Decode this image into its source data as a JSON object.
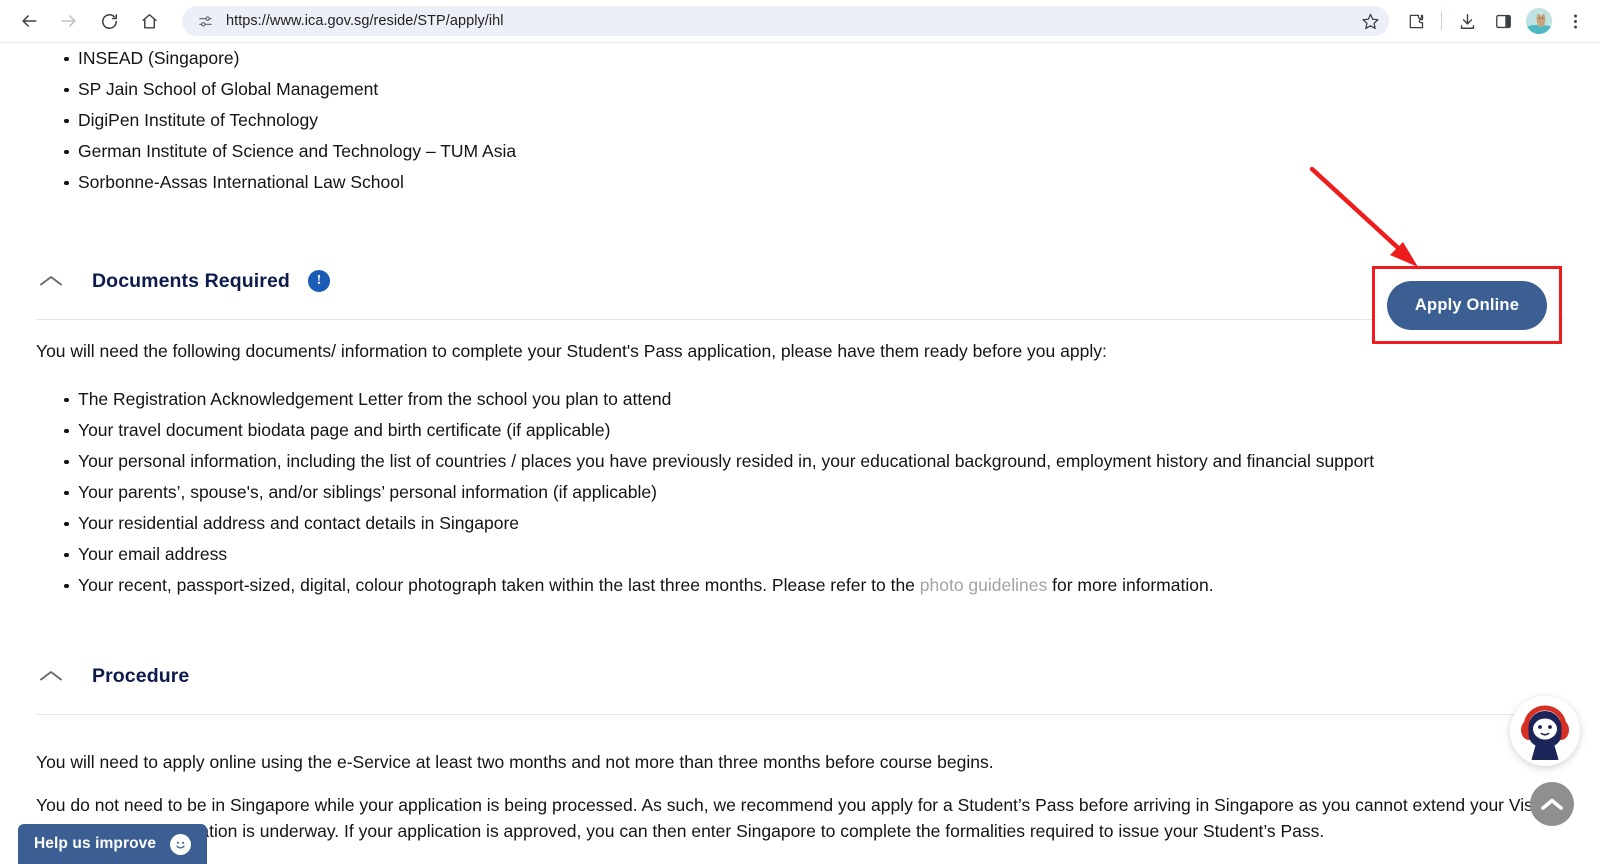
{
  "browser": {
    "back_label": "Back",
    "forward_label": "Forward",
    "reload_label": "Reload",
    "home_label": "Home",
    "site_info_icon": "tune-icon",
    "url": "https://www.ica.gov.sg/reside/STP/apply/ihl",
    "bookmark_icon": "star-icon",
    "extensions_icon": "puzzle-icon",
    "downloads_icon": "download-icon",
    "side_panel_icon": "side-panel-icon",
    "profile_icon": "avatar-icon",
    "menu_icon": "three-dot-menu-icon"
  },
  "top_list": {
    "items": [
      "INSEAD (Singapore)",
      "SP Jain School of Global Management",
      "DigiPen Institute of Technology",
      "German Institute of Science and Technology – TUM Asia",
      "Sorbonne-Assas International Law School"
    ]
  },
  "documents_section": {
    "collapse_icon": "chevron-up-icon",
    "title": "Documents Required",
    "info_badge": "!",
    "intro": "You will need the following documents/ information to complete your Student's Pass application, please have them ready before you apply:",
    "items": [
      "The Registration Acknowledgement Letter from the school you plan to attend",
      "Your travel document biodata page and birth certificate (if applicable)",
      "Your personal information, including the list of countries / places you have previously resided in, your educational background, employment history and financial support",
      "Your parents’, spouse's, and/or siblings’ personal information (if applicable)",
      "Your residential address and contact details in Singapore",
      "Your email address"
    ],
    "photo_item_prefix": "Your recent, passport-sized, digital, colour photograph taken within the last three months. Please refer to the ",
    "photo_item_link": "photo guidelines",
    "photo_item_suffix": " for more information."
  },
  "apply": {
    "button_label": "Apply Online",
    "highlight_color": "#ee1c1c",
    "button_color": "#3b5f93",
    "arrow_color": "#ee1c1c"
  },
  "procedure_section": {
    "collapse_icon": "chevron-up-icon",
    "title": "Procedure",
    "paragraph_1": "You will need to apply online using the e-Service at least two months and not more than three months before course begins.",
    "paragraph_2": "You do not need to be in Singapore while your application is being processed. As such, we recommend you apply for a Student’s Pass before arriving in Singapore as you cannot extend your Visit Pass while the application is underway. If your application is approved, you can then enter Singapore to complete the formalities required to issue your Student’s Pass."
  },
  "floating": {
    "chatbot_icon": "chatbot-avatar-icon",
    "scroll_top_icon": "chevron-up-icon",
    "feedback_label": "Help us improve",
    "feedback_icon": "smiley-icon",
    "feedback_color": "#3b5f93"
  }
}
